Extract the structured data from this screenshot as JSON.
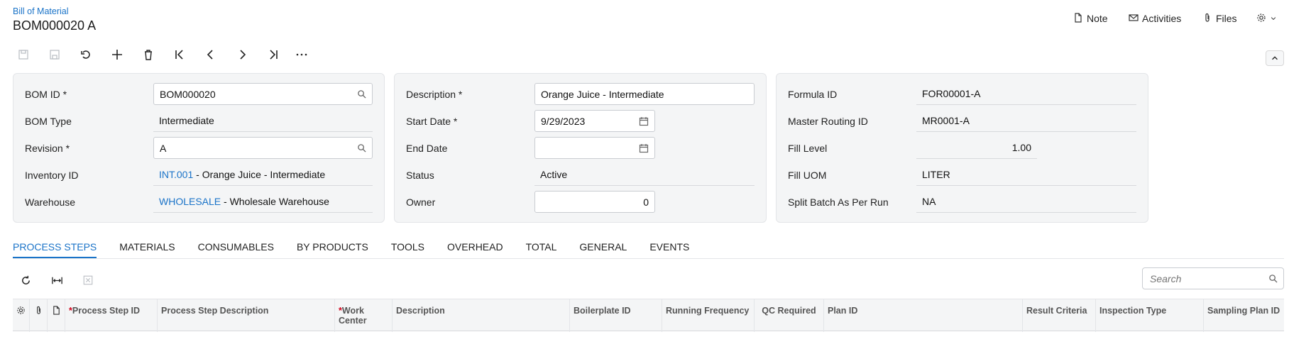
{
  "header": {
    "breadcrumb": "Bill of Material",
    "title": "BOM000020 A",
    "actions": {
      "note": "Note",
      "activities": "Activities",
      "files": "Files"
    }
  },
  "form": {
    "bom_id": {
      "label": "BOM ID",
      "value": "BOM000020"
    },
    "bom_type": {
      "label": "BOM Type",
      "value": "Intermediate"
    },
    "revision": {
      "label": "Revision",
      "value": "A"
    },
    "inventory_id": {
      "label": "Inventory ID",
      "link": "INT.001",
      "desc": " - Orange Juice - Intermediate"
    },
    "warehouse": {
      "label": "Warehouse",
      "link": "WHOLESALE",
      "desc": " - Wholesale Warehouse"
    },
    "description": {
      "label": "Description",
      "value": "Orange Juice - Intermediate"
    },
    "start_date": {
      "label": "Start Date",
      "value": "9/29/2023"
    },
    "end_date": {
      "label": "End Date",
      "value": ""
    },
    "status": {
      "label": "Status",
      "value": "Active"
    },
    "owner": {
      "label": "Owner",
      "value": "0"
    },
    "formula_id": {
      "label": "Formula ID",
      "value": "FOR00001-A"
    },
    "master_routing_id": {
      "label": "Master Routing ID",
      "value": "MR0001-A"
    },
    "fill_level": {
      "label": "Fill Level",
      "value": "1.00"
    },
    "fill_uom": {
      "label": "Fill UOM",
      "value": "LITER"
    },
    "split_batch": {
      "label": "Split Batch As Per Run",
      "value": "NA"
    },
    "required_mark": "*"
  },
  "tabs": [
    "PROCESS STEPS",
    "MATERIALS",
    "CONSUMABLES",
    "BY PRODUCTS",
    "TOOLS",
    "OVERHEAD",
    "TOTAL",
    "GENERAL",
    "EVENTS"
  ],
  "grid": {
    "search_placeholder": "Search",
    "columns": {
      "process_step_id": "Process Step ID",
      "process_step_description": "Process Step Description",
      "work_center": "Work Center",
      "description": "Description",
      "boilerplate_id": "Boilerplate ID",
      "running_frequency": "Running Frequency",
      "qc_required": "QC Required",
      "plan_id": "Plan ID",
      "result_criteria": "Result Criteria",
      "inspection_type": "Inspection Type",
      "sampling_plan_id": "Sampling Plan ID"
    },
    "required_mark": "*"
  },
  "colors": {
    "accent": "#1a73c8",
    "panel_bg": "#f4f5f6",
    "required": "#d0021b"
  }
}
